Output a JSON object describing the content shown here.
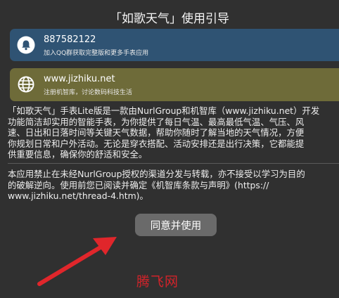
{
  "dialog": {
    "title": "「如歌天气」使用引导"
  },
  "qq_card": {
    "number": "887582122",
    "description": "加入QQ群获取完整版和更多手表应用",
    "icon": "bell-icon",
    "color": "#2f5373"
  },
  "web_card": {
    "url": "www.jizhiku.net",
    "description": "注册机智库，讨论数码科技生活",
    "icon": "globe-icon",
    "color": "#6e6b39"
  },
  "intro_lines": [
    "「如歌天气」手表Lite版是一款由NurlGroup和机智库（www.jizhiku.net）开发",
    "功能简洁却实用的智能手表，为你提供了每日气温、最高最低气温、气压、风",
    "速、日出和日落时间等关键天气数据，帮助你随时了解当地的天气情况，方便",
    "你规划日常和户外活动。无论是穿衣搭配、活动安排还是出行决策，它都能提",
    "供重要信息，确保你的舒适和安全。"
  ],
  "notice_lines": [
    "本应用禁止在未经NurlGroup授权的渠道分发与转载，亦不接受以学习为目的",
    "的破解逆向。使用前您已阅读并确定《机智库条款与声明》(https://",
    "www.jizhiku.net/thread-4.htm)。"
  ],
  "agree_button": {
    "label": "同意并使用"
  },
  "watermark": {
    "text": "腾飞网",
    "color": "#d2232a"
  },
  "annotation_arrow": {
    "color": "#e0262b"
  }
}
